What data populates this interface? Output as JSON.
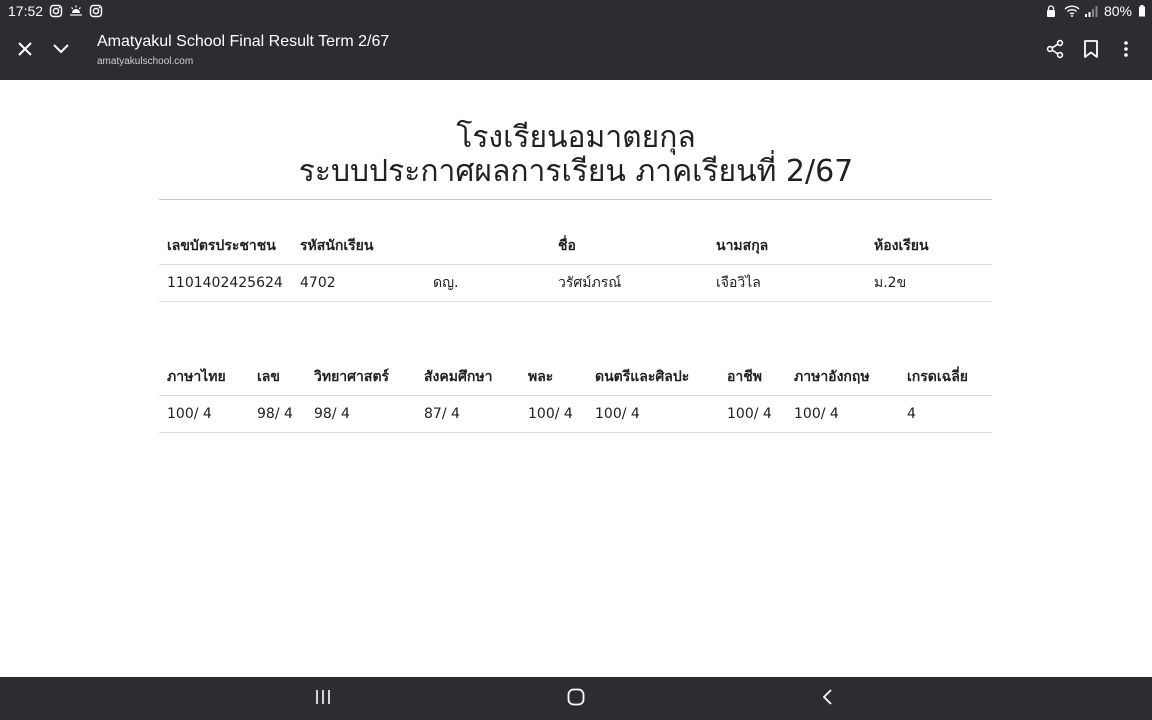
{
  "status_bar": {
    "time": "17:52",
    "battery": "80%"
  },
  "toolbar": {
    "title": "Amatyakul School Final Result Term 2/67",
    "url": "amatyakulschool.com"
  },
  "page": {
    "school_name": "โรงเรียนอมาตยกุล",
    "system_title": "ระบบประกาศผลการเรียน ภาคเรียนที่ 2/67"
  },
  "student_table": {
    "headers": [
      "เลขบัตรประชาชน",
      "รหัสนักเรียน",
      "",
      "ชื่อ",
      "นามสกุล",
      "ห้องเรียน"
    ],
    "row": [
      "1101402425624",
      "4702",
      "ดญ.",
      "วรัศม์ภรณ์",
      "เจือวิไล",
      "ม.2ข"
    ]
  },
  "grades_table": {
    "headers": [
      "ภาษาไทย",
      "เลข",
      "วิทยาศาสตร์",
      "สังคมศึกษา",
      "พละ",
      "ดนตรีและศิลปะ",
      "อาชีพ",
      "ภาษาอังกฤษ",
      "เกรดเฉลี่ย"
    ],
    "row": [
      "100/ 4",
      "98/ 4",
      "98/ 4",
      "87/ 4",
      "100/ 4",
      "100/ 4",
      "100/ 4",
      "100/ 4",
      "4"
    ]
  },
  "icons": {
    "status_left": [
      "instagram-icon",
      "weather-icon",
      "instagram-icon"
    ],
    "status_right": [
      "lock-icon",
      "wifi-icon",
      "signal-icon",
      "battery-icon"
    ],
    "toolbar": [
      "close-icon",
      "chevron-down-icon",
      "share-icon",
      "bookmark-icon",
      "more-vert-icon"
    ],
    "nav": [
      "recents-icon",
      "home-icon",
      "back-icon"
    ]
  },
  "colors": {
    "chrome_bg": "#2b2d30",
    "page_bg": "#ffffff",
    "text": "#212121"
  }
}
